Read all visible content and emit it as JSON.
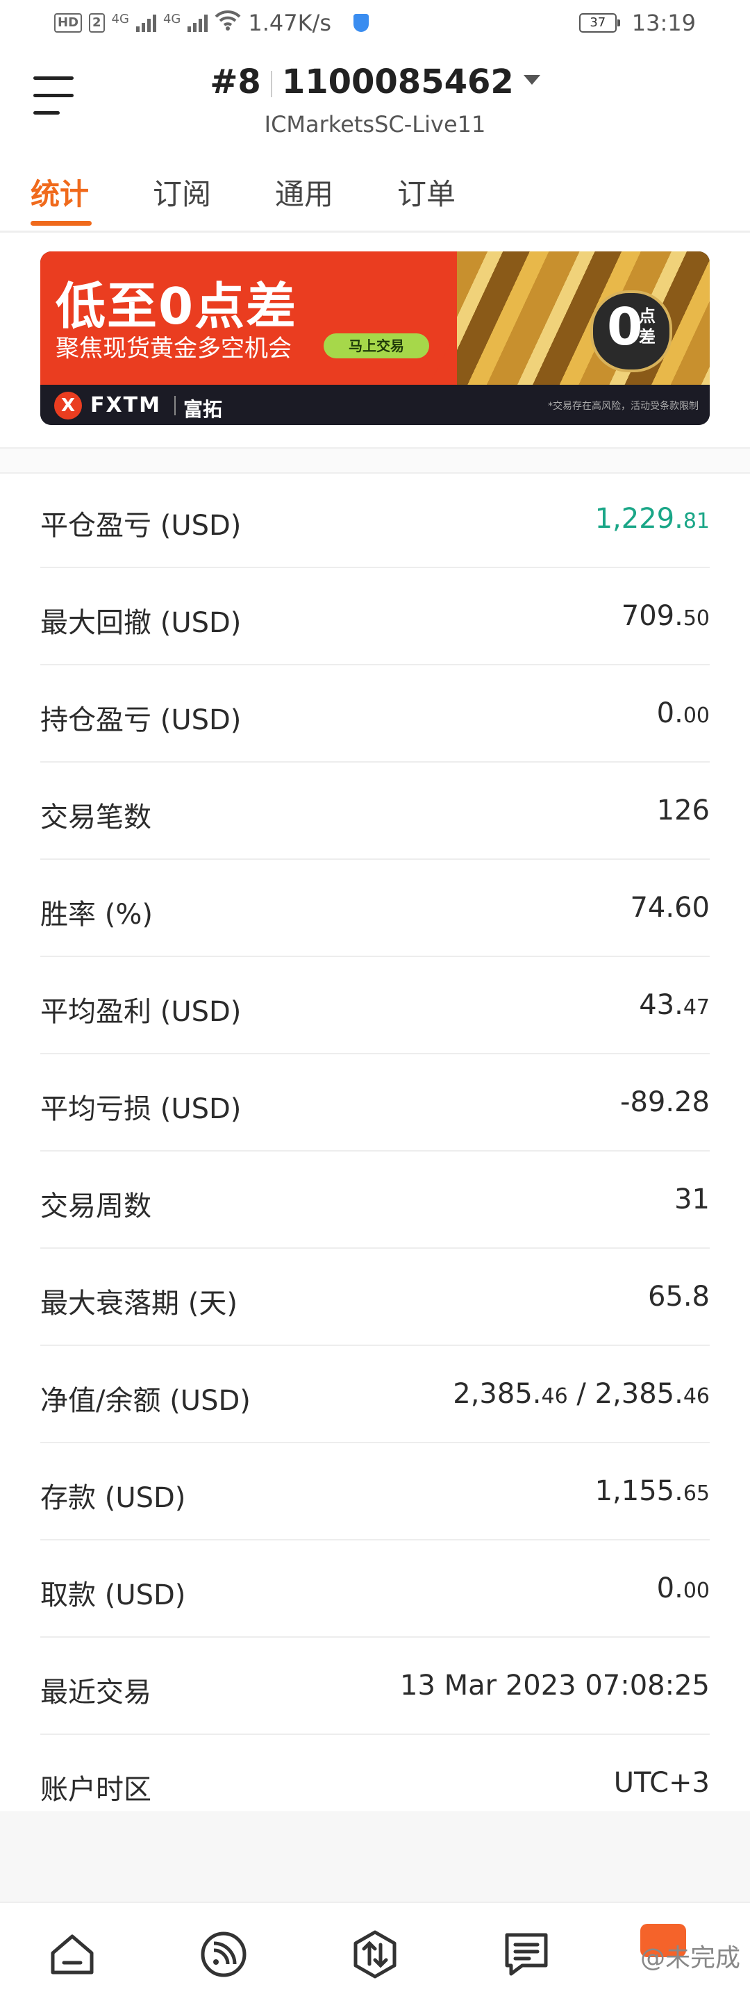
{
  "status_bar": {
    "hd_badge": "HD",
    "sim_badge": "2",
    "net1": "4G",
    "net2": "4G",
    "speed": "1.47K/s",
    "battery": "37",
    "time": "13:19"
  },
  "header": {
    "account_index": "#8",
    "account_number": "1100085462",
    "server": "ICMarketsSC-Live11"
  },
  "tabs": [
    {
      "label": "统计",
      "active": true
    },
    {
      "label": "订阅",
      "active": false
    },
    {
      "label": "通用",
      "active": false
    },
    {
      "label": "订单",
      "active": false
    }
  ],
  "banner": {
    "title": "低至0点差",
    "subtitle": "聚焦现货黄金多空机会",
    "button": "马上交易",
    "badge_big": "0",
    "badge_small": "点差",
    "brand": "FXTM",
    "brand_cn": "富拓",
    "logo_mark": "X",
    "disclaimer": "*交易存在高风险，活动受条款限制"
  },
  "stats": [
    {
      "label": "平仓盈亏 (USD)",
      "main": "1,229.",
      "decimal": "81",
      "color": "#1aa687"
    },
    {
      "label": "最大回撤 (USD)",
      "main": "709.",
      "decimal": "50"
    },
    {
      "label": "持仓盈亏 (USD)",
      "main": "0.",
      "decimal": "00"
    },
    {
      "label": "交易笔数",
      "main": "126",
      "decimal": ""
    },
    {
      "label": "胜率 (%)",
      "main": "74.60",
      "decimal": ""
    },
    {
      "label": "平均盈利 (USD)",
      "main": "43.",
      "decimal": "47"
    },
    {
      "label": "平均亏损 (USD)",
      "main": "-89.28",
      "decimal": ""
    },
    {
      "label": "交易周数",
      "main": "31",
      "decimal": ""
    },
    {
      "label": "最大衰落期 (天)",
      "main": "65.8",
      "decimal": ""
    },
    {
      "label": "净值/余额 (USD)",
      "main": "2,385.",
      "decimal": "46",
      "main2": " / 2,385.",
      "decimal2": "46"
    },
    {
      "label": "存款 (USD)",
      "main": "1,155.",
      "decimal": "65"
    },
    {
      "label": "取款 (USD)",
      "main": "0.",
      "decimal": "00"
    },
    {
      "label": "最近交易",
      "main": "13 Mar 2023 07:08:25",
      "decimal": ""
    },
    {
      "label": "账户时区",
      "main": "UTC+3",
      "decimal": ""
    }
  ],
  "bottom_nav": {
    "icons": [
      "home-icon",
      "signal-feed-icon",
      "trade-icon",
      "news-icon"
    ],
    "watermark": "@未完成"
  }
}
